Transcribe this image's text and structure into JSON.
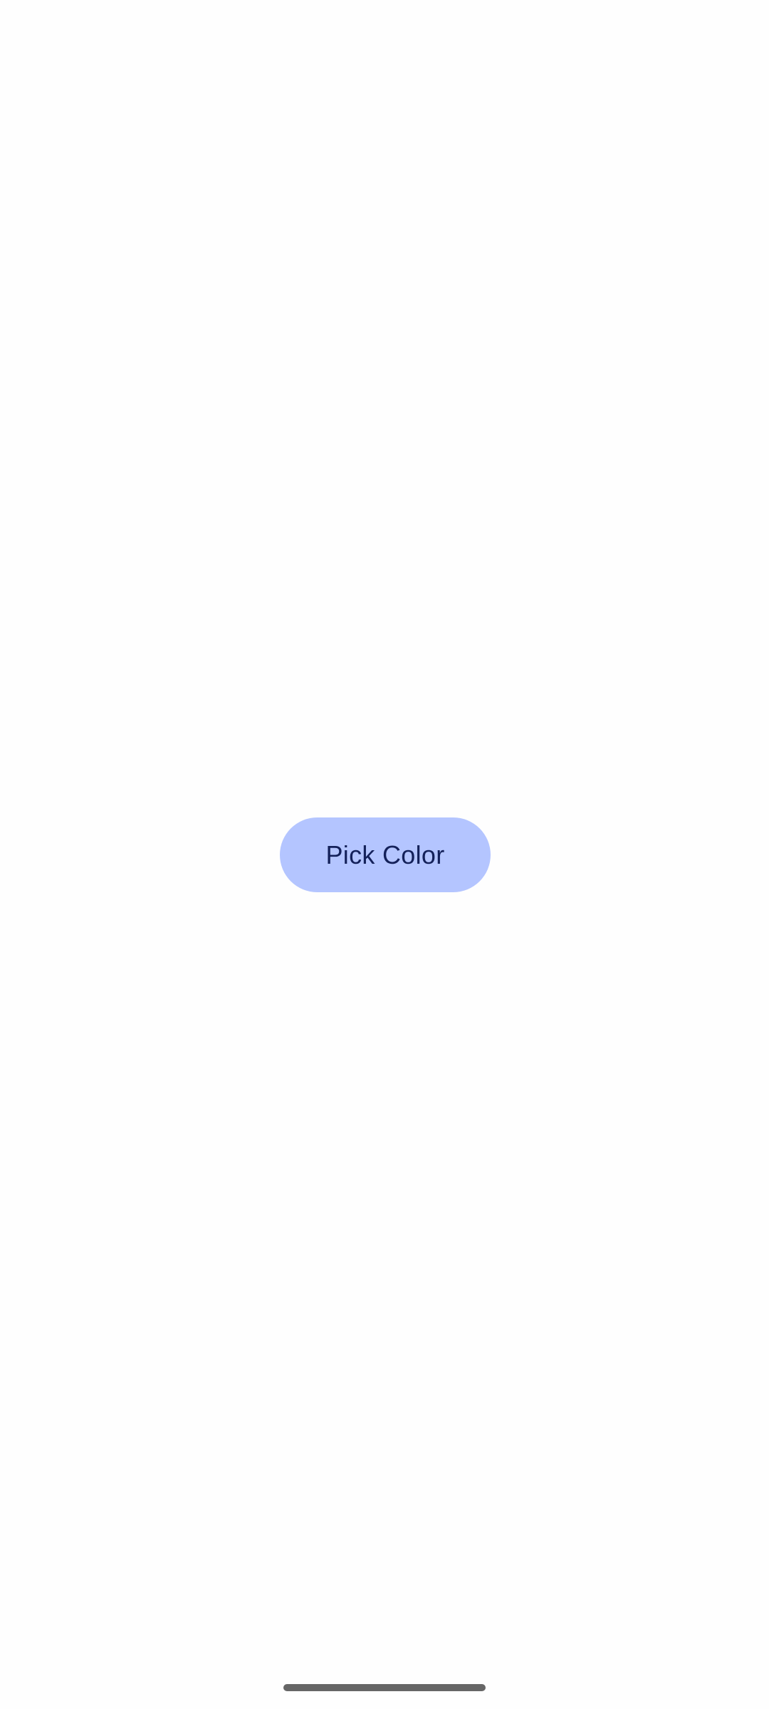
{
  "main": {
    "pick_color_label": "Pick Color"
  },
  "colors": {
    "background": "#fefefe",
    "button_background": "#b4c5ff",
    "button_text": "#14215a",
    "gesture_bar": "#666666"
  }
}
